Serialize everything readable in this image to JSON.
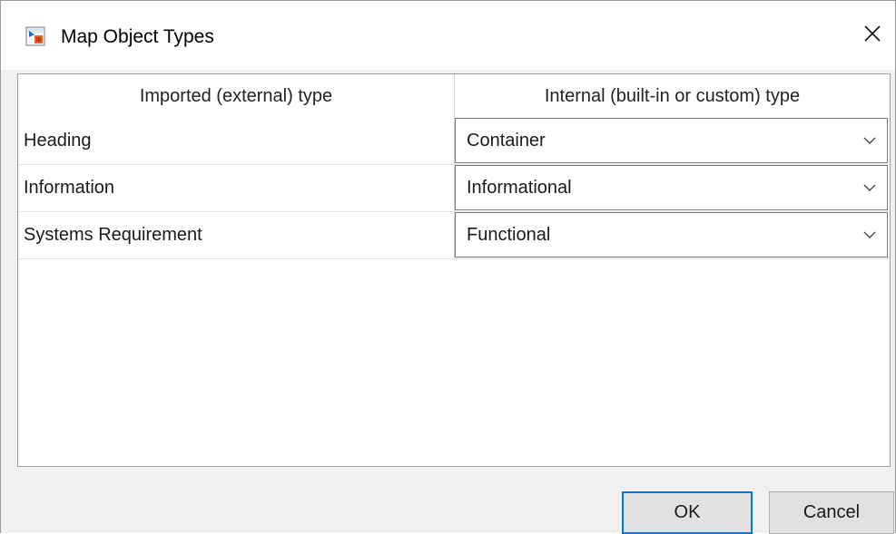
{
  "window": {
    "title": "Map Object Types",
    "app_icon": "simulink-app-icon",
    "close_icon": "close-icon"
  },
  "table": {
    "headers": [
      "Imported (external) type",
      "Internal (built-in or custom) type"
    ],
    "rows": [
      {
        "imported": "Heading",
        "internal": "Container"
      },
      {
        "imported": "Information",
        "internal": "Informational"
      },
      {
        "imported": "Systems Requirement",
        "internal": "Functional"
      }
    ]
  },
  "buttons": {
    "ok": "OK",
    "cancel": "Cancel"
  },
  "colors": {
    "focus_border": "#0078d7",
    "dialog_bg": "#f0f0f0"
  }
}
